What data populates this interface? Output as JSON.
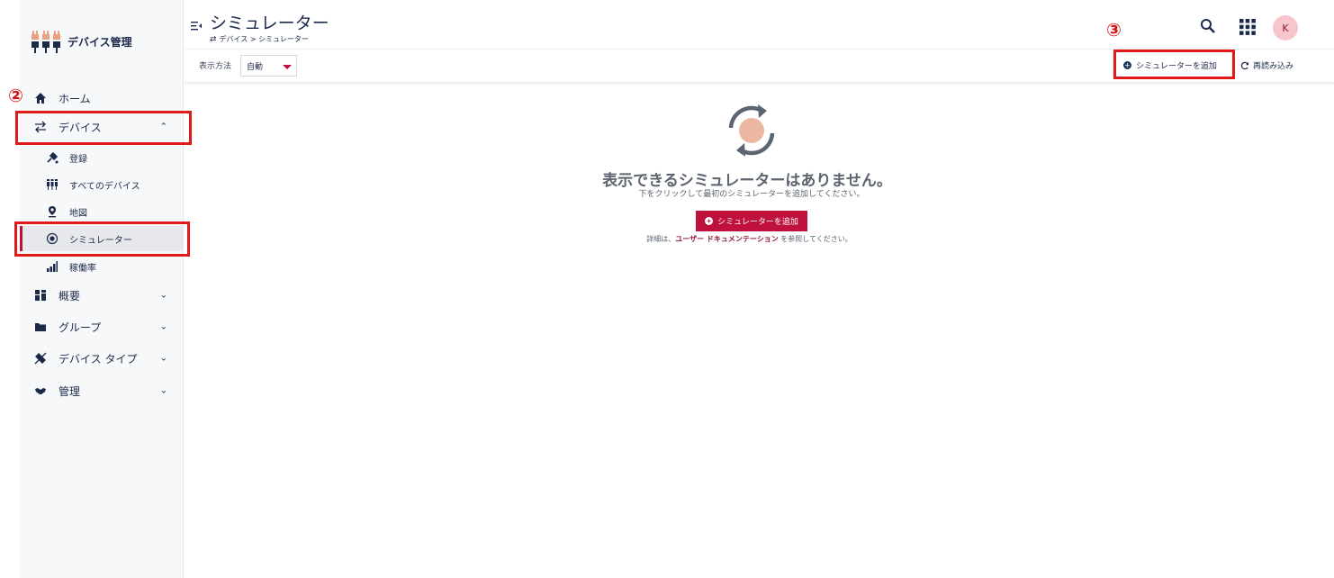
{
  "app": {
    "brand_name": "デバイス管理",
    "avatar_initial": "K",
    "accent_color": "#c0113d",
    "navy_color": "#1c2a4a"
  },
  "sidebar": {
    "items": [
      {
        "label": "ホーム",
        "icon": "home-icon"
      },
      {
        "label": "デバイス",
        "icon": "swap-arrows-icon",
        "expanded": true
      },
      {
        "label": "登録",
        "icon": "plug-icon"
      },
      {
        "label": "すべてのデバイス",
        "icon": "devices-icon"
      },
      {
        "label": "地図",
        "icon": "map-pin-icon"
      },
      {
        "label": "シミュレーター",
        "icon": "simulator-icon",
        "active": true
      },
      {
        "label": "稼働率",
        "icon": "bar-chart-icon"
      },
      {
        "label": "概要",
        "icon": "dashboard-icon"
      },
      {
        "label": "グループ",
        "icon": "folder-icon"
      },
      {
        "label": "デバイス タイプ",
        "icon": "device-type-icon"
      },
      {
        "label": "管理",
        "icon": "handshake-icon"
      }
    ]
  },
  "header": {
    "title": "シミュレーター",
    "breadcrumb": "デバイス > シミュレーター",
    "view_label": "表示方法",
    "view_value": "自動",
    "add_simulator": "シミュレーターを追加",
    "reload": "再読み込み"
  },
  "empty_state": {
    "title": "表示できるシミュレーターはありません。",
    "subtitle": "下をクリックして最初のシミュレーターを追加してください。",
    "button": "シミュレーターを追加",
    "docs_prefix": "詳細は、",
    "docs_link": "ユーザー ドキュメンテーション",
    "docs_suffix": " を参照してください。"
  },
  "annotations": {
    "step2": "②",
    "step3": "③"
  }
}
